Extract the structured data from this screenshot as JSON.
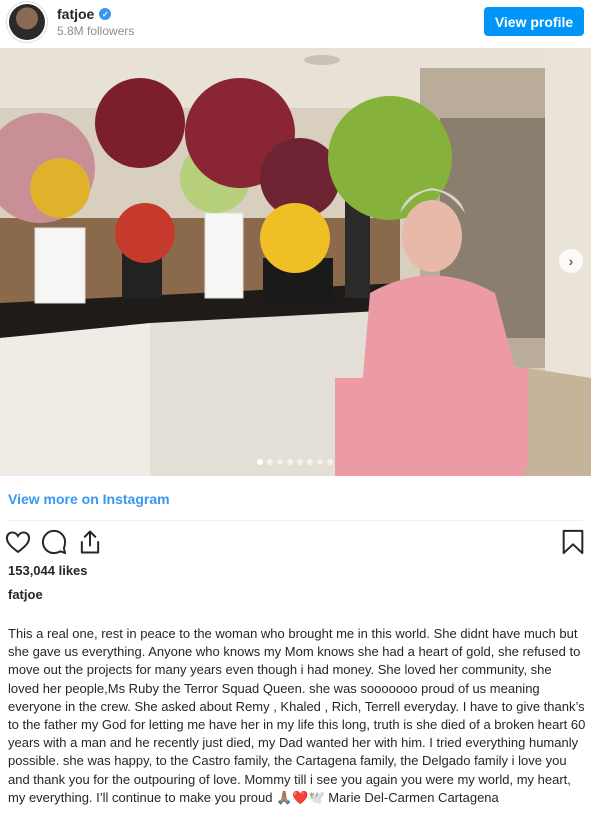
{
  "header": {
    "username": "fatjoe",
    "followers": "5.8M followers",
    "view_profile_label": "View profile"
  },
  "carousel": {
    "slide_count": 8,
    "active_slide": 1
  },
  "links": {
    "view_more": "View more on Instagram"
  },
  "post": {
    "likes": "153,044 likes",
    "author": "fatjoe",
    "caption": "This a real one, rest in peace to the woman who brought me in this world. She didnt have much but she gave us everything. Anyone who knows my Mom knows she had a heart of gold, she refused to move out the projects for many years even though i had money. She loved her community, she loved her people,Ms Ruby the Terror Squad Queen. she was sooooooo proud of us meaning everyone in the crew. She asked about Remy , Khaled , Rich, Terrell everyday. I have to give thank’s to the father my God for letting me have her in my life this long, truth is she died of a broken heart 60 years with a man and he recently just died, my Dad wanted her with him. I tried everything humanly possible. she was happy, to the Castro family, the Cartagena family, the Delgado family i love you and thank you for the outpouring of love. Mommy till i see you again you were my world, my heart, my everything. I’ll continue to make you proud 🙏🏽❤️🕊️ Marie Del-Carmen Cartagena"
  },
  "colors": {
    "accent": "#0095f6",
    "link": "#3897f0",
    "text": "#262626",
    "muted": "#8e8e8e"
  },
  "icons": [
    "heart-icon",
    "comment-icon",
    "share-icon",
    "bookmark-icon",
    "verified-icon",
    "chevron-right-icon"
  ]
}
